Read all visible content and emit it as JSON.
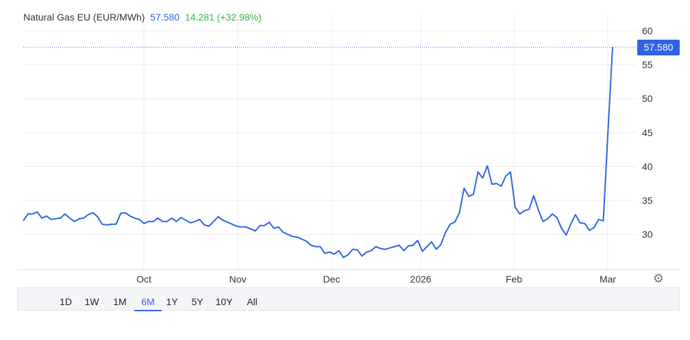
{
  "legend": {
    "name": "Natural Gas EU (EUR/MWh)",
    "price": "57.580",
    "change": "14.281 (+32.98%)"
  },
  "current_price_tag": "57.580",
  "colors": {
    "line": "#2f63e3",
    "price_blue": "#2f63e3",
    "change_green": "#33b24a",
    "grid": "#ececec"
  },
  "settings_icon": "gear-icon",
  "ranges": {
    "items": [
      "1D",
      "1W",
      "1M",
      "6M",
      "1Y",
      "5Y",
      "10Y",
      "All"
    ],
    "active": "6M"
  },
  "chart_data": {
    "type": "line",
    "title": "",
    "xlabel": "",
    "ylabel": "",
    "ylim": [
      25,
      61
    ],
    "y_ticks": [
      30,
      35,
      40,
      45,
      50,
      55,
      60
    ],
    "x_tick_labels": [
      "Oct",
      "Nov",
      "Dec",
      "2026",
      "Feb",
      "Mar"
    ],
    "grid": true,
    "y_axis_position": "right",
    "last_value": 57.58,
    "series": [
      {
        "values": [
          32.0,
          33.0,
          33.0,
          33.3,
          32.4,
          32.7,
          32.2,
          32.3,
          32.4,
          33.0,
          32.4,
          31.9,
          32.3,
          32.4,
          32.9,
          33.2,
          32.6,
          31.5,
          31.4,
          31.5,
          31.5,
          33.1,
          33.2,
          32.7,
          32.4,
          32.2,
          31.6,
          31.9,
          31.9,
          32.4,
          31.9,
          31.9,
          32.4,
          31.9,
          32.5,
          32.1,
          31.7,
          31.9,
          32.2,
          31.4,
          31.2,
          31.9,
          32.6,
          32.1,
          31.8,
          31.5,
          31.2,
          31.1,
          31.1,
          30.8,
          30.5,
          31.3,
          31.3,
          31.8,
          30.9,
          31.1,
          30.3,
          30.0,
          29.7,
          29.6,
          29.3,
          29.0,
          28.4,
          28.2,
          28.2,
          27.2,
          27.4,
          27.1,
          27.6,
          26.6,
          27.0,
          27.8,
          27.7,
          26.8,
          27.4,
          27.6,
          28.2,
          27.9,
          27.8,
          28.0,
          28.2,
          28.4,
          27.6,
          28.3,
          28.4,
          29.1,
          27.5,
          28.2,
          28.9,
          27.8,
          28.5,
          30.3,
          31.5,
          31.8,
          33.2,
          36.8,
          35.6,
          35.9,
          39.2,
          38.3,
          40.1,
          37.4,
          37.5,
          37.1,
          38.6,
          39.2,
          34.0,
          33.0,
          33.5,
          33.7,
          35.7,
          33.6,
          31.9,
          32.3,
          33.0,
          32.5,
          30.9,
          29.9,
          31.5,
          32.9,
          31.7,
          31.6,
          30.6,
          31.0,
          32.2,
          32.0,
          45.0,
          57.58
        ]
      }
    ]
  }
}
